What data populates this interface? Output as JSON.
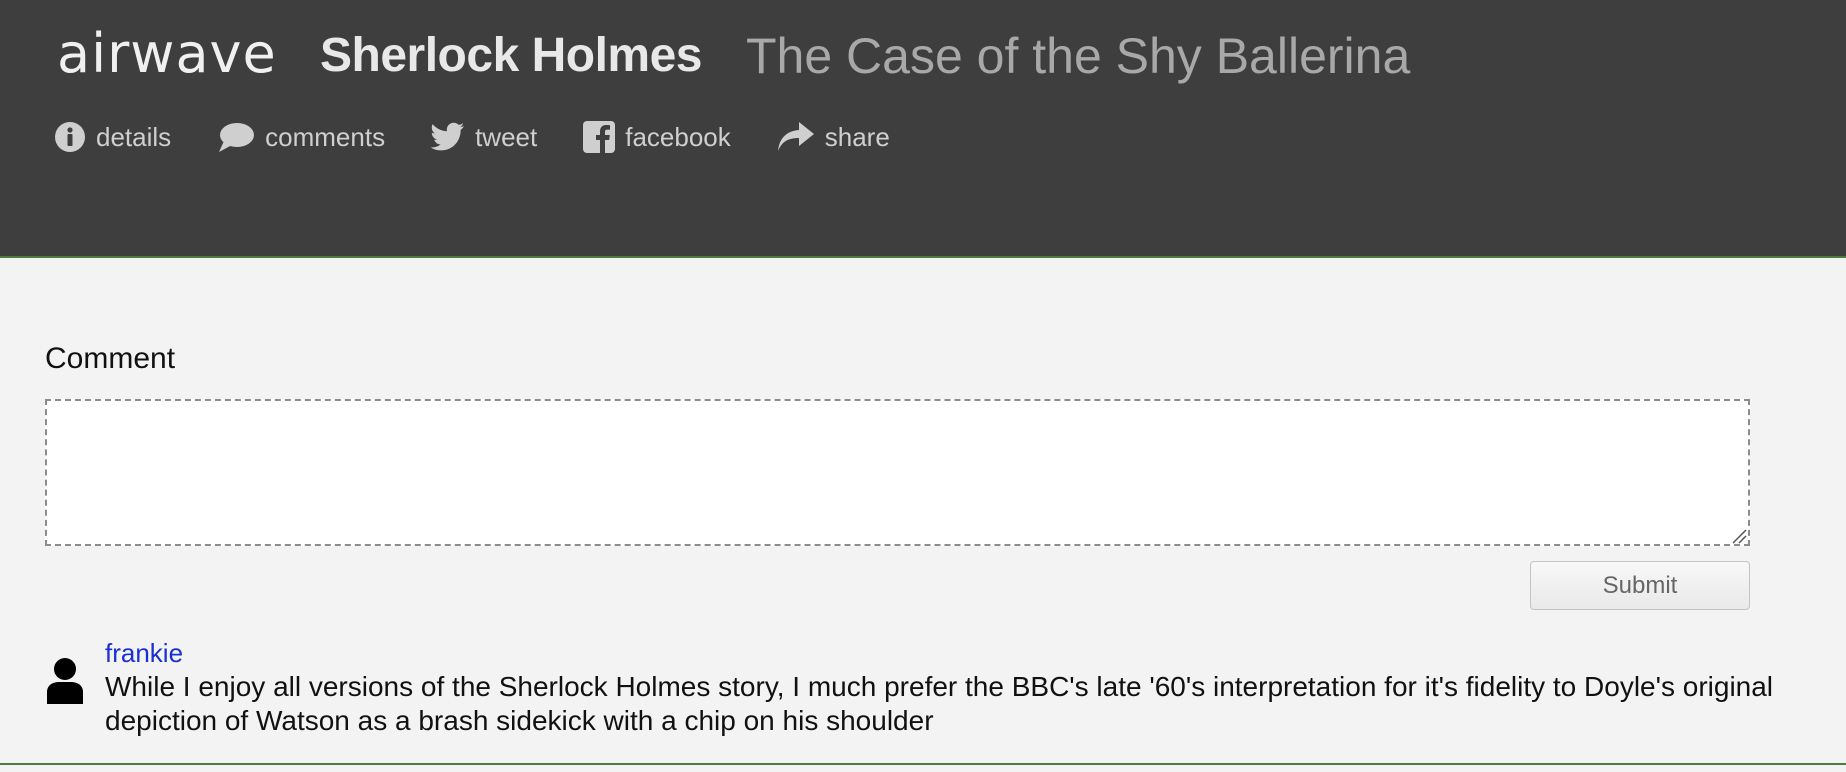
{
  "header": {
    "brand": "airwave",
    "show_title": "Sherlock Holmes",
    "episode_title": "The Case of the Shy Ballerina"
  },
  "nav": {
    "items": [
      {
        "label": "details",
        "icon": "info-icon"
      },
      {
        "label": "comments",
        "icon": "speech-bubble-icon"
      },
      {
        "label": "tweet",
        "icon": "twitter-icon"
      },
      {
        "label": "facebook",
        "icon": "facebook-icon"
      },
      {
        "label": "share",
        "icon": "share-arrow-icon"
      }
    ]
  },
  "comment_form": {
    "heading": "Comment",
    "textarea_value": "",
    "submit_label": "Submit"
  },
  "comments": [
    {
      "author": "frankie",
      "avatar_icon": "user-silhouette-icon",
      "text": "While I enjoy all versions of the Sherlock Holmes story, I much prefer the BBC's late '60's interpretation for it's fidelity to Doyle's original depiction of Watson as a brash sidekick with a chip on his shoulder"
    }
  ],
  "colors": {
    "header_bg": "#3e3e3e",
    "accent_line": "#4a7d3a",
    "author_link": "#1a2fd4",
    "page_bg": "#f3f3f3"
  }
}
